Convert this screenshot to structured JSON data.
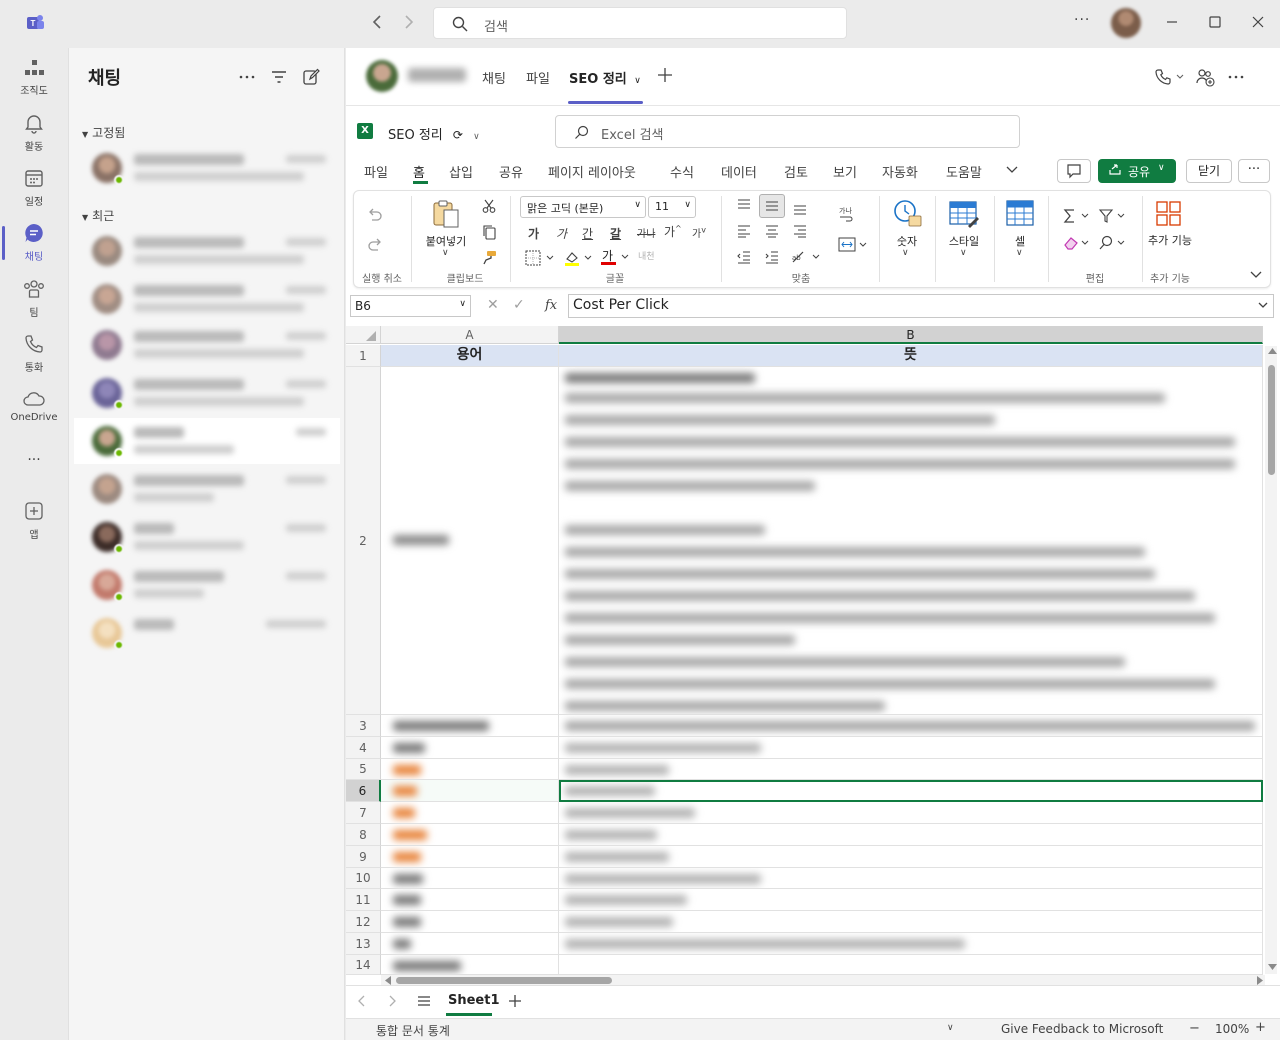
{
  "titlebar": {
    "search_placeholder": "검색",
    "more": "···"
  },
  "rail": {
    "items": [
      {
        "label": "조직도",
        "icon": "org-chart-icon"
      },
      {
        "label": "활동",
        "icon": "bell-icon"
      },
      {
        "label": "일정",
        "icon": "calendar-icon"
      },
      {
        "label": "채팅",
        "icon": "chat-icon",
        "active": true
      },
      {
        "label": "팀",
        "icon": "teams-icon"
      },
      {
        "label": "통화",
        "icon": "phone-icon"
      },
      {
        "label": "OneDrive",
        "icon": "cloud-icon"
      },
      {
        "label": "앱",
        "icon": "add-app-icon"
      }
    ],
    "more": "···"
  },
  "chatlist": {
    "title": "채팅",
    "pinned_label": "고정됨",
    "recent_label": "최근"
  },
  "main": {
    "tabs": [
      "채팅",
      "파일",
      "SEO 정리"
    ],
    "active_tab": "SEO 정리"
  },
  "excel": {
    "doc_name": "SEO 정리",
    "search_placeholder": "Excel 검색",
    "ribbon_tabs": [
      "파일",
      "홈",
      "삽입",
      "공유",
      "페이지 레이아웃",
      "수식",
      "데이터",
      "검토",
      "보기",
      "자동화",
      "도움말"
    ],
    "share_label": "공유",
    "close_label": "닫기",
    "more_label": "···",
    "ribbon": {
      "undo_group": "실행 취소",
      "paste_label": "붙여넣기",
      "clipboard_group": "클립보드",
      "font_name": "맑은 고딕 (본문)",
      "font_size": "11",
      "font_group": "글꼴",
      "align_group": "맞춤",
      "number_label": "숫자",
      "style_label": "스타일",
      "cell_label": "셀",
      "edit_group": "편집",
      "addin_label": "추가 기능",
      "addin_group": "추가 기능"
    },
    "name_box": "B6",
    "formula": "Cost Per Click",
    "columns": [
      "A",
      "B"
    ],
    "rows": [
      "1",
      "2",
      "3",
      "4",
      "5",
      "6",
      "7",
      "8",
      "9",
      "10",
      "11",
      "12",
      "13",
      "14"
    ],
    "header_row": {
      "a": "용어",
      "b": "뜻"
    },
    "sheet_name": "Sheet1",
    "status": {
      "workbook_stats": "통합 문서 통계",
      "feedback": "Give Feedback to Microsoft",
      "zoom": "100%"
    }
  },
  "colors": {
    "accent": "#5b5fc7",
    "excel_green": "#107c41",
    "header_fill": "#dae3f3",
    "orange_text": "#e8833a"
  }
}
